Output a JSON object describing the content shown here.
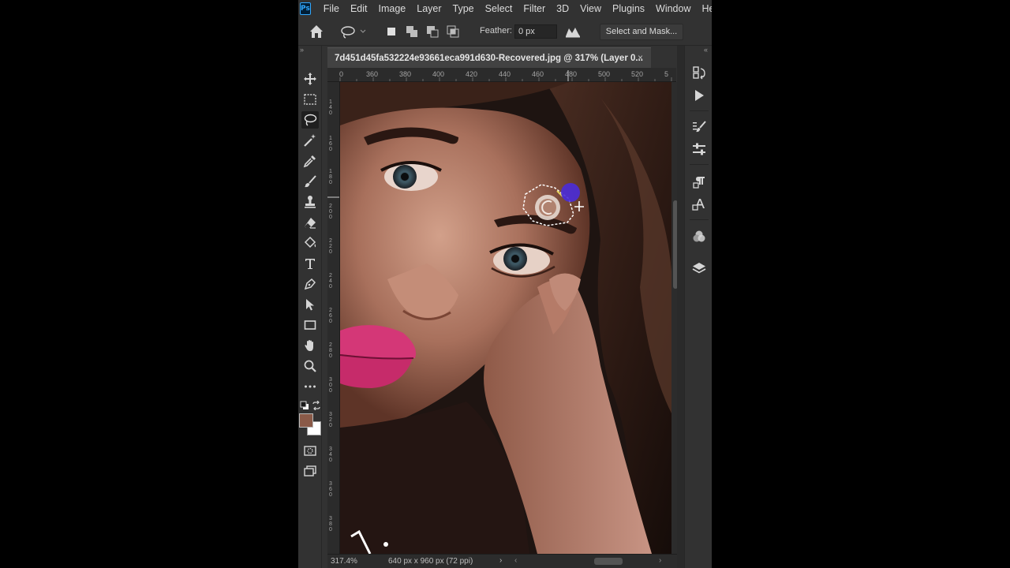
{
  "app": {
    "logo_text": "Ps"
  },
  "menu": [
    "File",
    "Edit",
    "Image",
    "Layer",
    "Type",
    "Select",
    "Filter",
    "3D",
    "View",
    "Plugins",
    "Window",
    "Help"
  ],
  "options_bar": {
    "feather_label": "Feather:",
    "feather_value": "0 px",
    "select_and_mask_label": "Select and Mask..."
  },
  "document": {
    "tab_title": "7d451d45fa532224e93661eca991d630-Recovered.jpg @ 317% (Layer 0...",
    "close_glyph": "×"
  },
  "rulers": {
    "horizontal": [
      "0",
      "360",
      "380",
      "400",
      "420",
      "440",
      "460",
      "480",
      "500",
      "520",
      "5"
    ],
    "vertical": [
      "1\n4\n0",
      "1\n6\n0",
      "1\n8\n0",
      "2\n0\n0",
      "2\n2\n0",
      "2\n4\n0",
      "2\n6\n0",
      "2\n8\n0",
      "3\n0\n0",
      "3\n2\n0",
      "3\n4\n0",
      "3\n6\n0",
      "3\n8\n0"
    ]
  },
  "status_bar": {
    "zoom": "317.4%",
    "doc_size": "640 px x 960 px (72 ppi)",
    "arrow": "›",
    "scroll_left": "‹",
    "scroll_right": "›"
  },
  "colors": {
    "foreground": "#8a5a48",
    "background": "#ffffff",
    "brush_cursor": "#4a2cd8"
  },
  "tools": [
    "move-icon",
    "marquee-icon",
    "lasso-icon",
    "magic-wand-icon",
    "eyedropper-icon",
    "brush-icon",
    "stamp-icon",
    "eraser-icon",
    "paint-bucket-icon",
    "type-icon",
    "pen-icon",
    "path-select-icon",
    "rectangle-icon",
    "hand-icon",
    "zoom-icon",
    "more-tools-icon"
  ],
  "dock_icons": [
    "history-icon",
    "actions-play-icon",
    "brush-settings-icon",
    "adjustments-icon",
    "paragraph-icon",
    "character-icon",
    "channels-icon",
    "layers-icon"
  ]
}
